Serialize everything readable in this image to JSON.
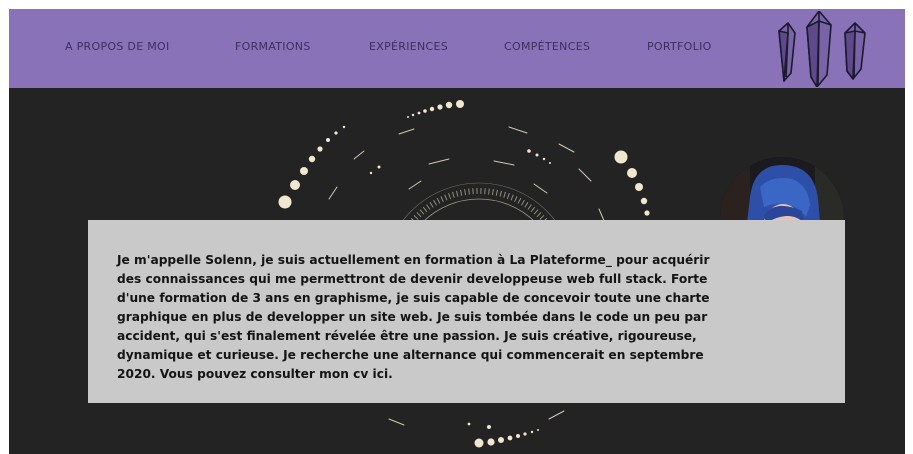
{
  "nav": {
    "items": [
      {
        "label": "A PROPOS DE MOI"
      },
      {
        "label": "FORMATIONS"
      },
      {
        "label": "EXPÉRIENCES"
      },
      {
        "label": "COMPÉTENCES"
      },
      {
        "label": "PORTFOLIO"
      }
    ]
  },
  "logo": {
    "icon": "crystals-icon"
  },
  "hero": {
    "illustration": "galaxy-moon-icon",
    "avatar": "profile-photo"
  },
  "about": {
    "text": "Je m'appelle Solenn, je suis actuellement en formation à La Plateforme_ pour acquérir des connaissances qui me permettront de devenir developpeuse web full stack. Forte d'une formation de 3 ans en graphisme, je suis capable de concevoir toute une charte graphique en plus de developper un site web. Je suis tombée dans le code un peu par accident, qui s'est finalement révelée être une passion. Je suis créative, rigoureuse, dynamique et curieuse. Je recherche une alternance qui commencerait en septembre 2020. Vous pouvez consulter mon cv ici."
  },
  "colors": {
    "nav_bg": "#8a72b8",
    "nav_text": "#3c2f5c",
    "page_bg": "#232323",
    "box_bg": "#c9c9c9",
    "accent_cream": "#f1e6cf"
  }
}
